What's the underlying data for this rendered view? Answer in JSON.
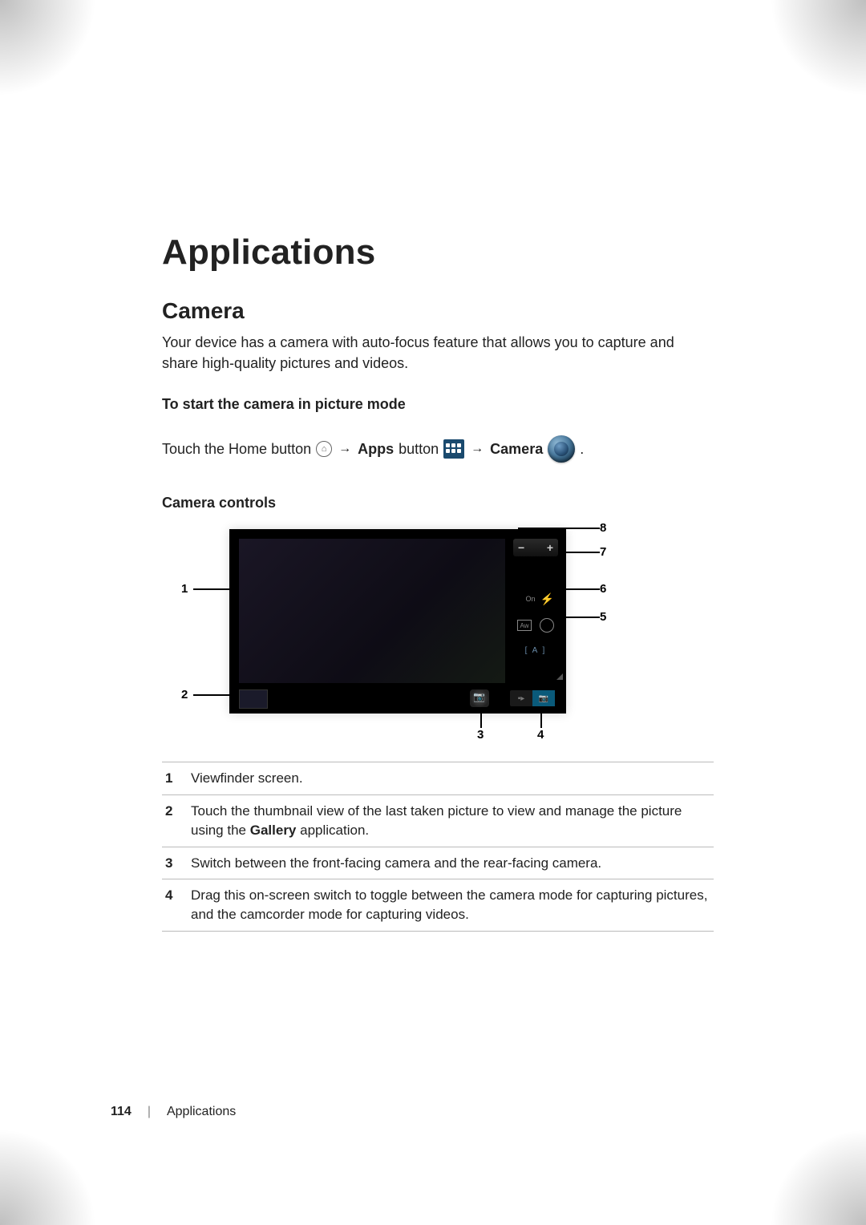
{
  "title": "Applications",
  "section": "Camera",
  "intro": "Your device has a camera with auto-focus feature that allows you to capture and share high-quality pictures and videos.",
  "start_heading": "To start the camera in picture mode",
  "nav": {
    "prefix": "Touch the Home button",
    "arrow": "→",
    "apps_label": "Apps",
    "button_word": "button",
    "camera_label": "Camera",
    "period": "."
  },
  "controls_heading": "Camera controls",
  "callouts": {
    "c1": "1",
    "c2": "2",
    "c3": "3",
    "c4": "4",
    "c5": "5",
    "c6": "6",
    "c7": "7",
    "c8": "8"
  },
  "camera_ui": {
    "zoom_minus": "−",
    "zoom_plus": "+",
    "flash_on": "On",
    "a_label": "[ A ]"
  },
  "legend": [
    {
      "n": "1",
      "text_a": "Viewfinder screen."
    },
    {
      "n": "2",
      "text_a": "Touch the thumbnail view of the last taken picture to view and manage the picture using the ",
      "bold": "Gallery",
      "text_b": " application."
    },
    {
      "n": "3",
      "text_a": "Switch between the front-facing camera and the rear-facing camera."
    },
    {
      "n": "4",
      "text_a": "Drag this on-screen switch to toggle between the camera mode for capturing pictures, and the camcorder mode for capturing videos."
    }
  ],
  "footer": {
    "page": "114",
    "section": "Applications"
  }
}
